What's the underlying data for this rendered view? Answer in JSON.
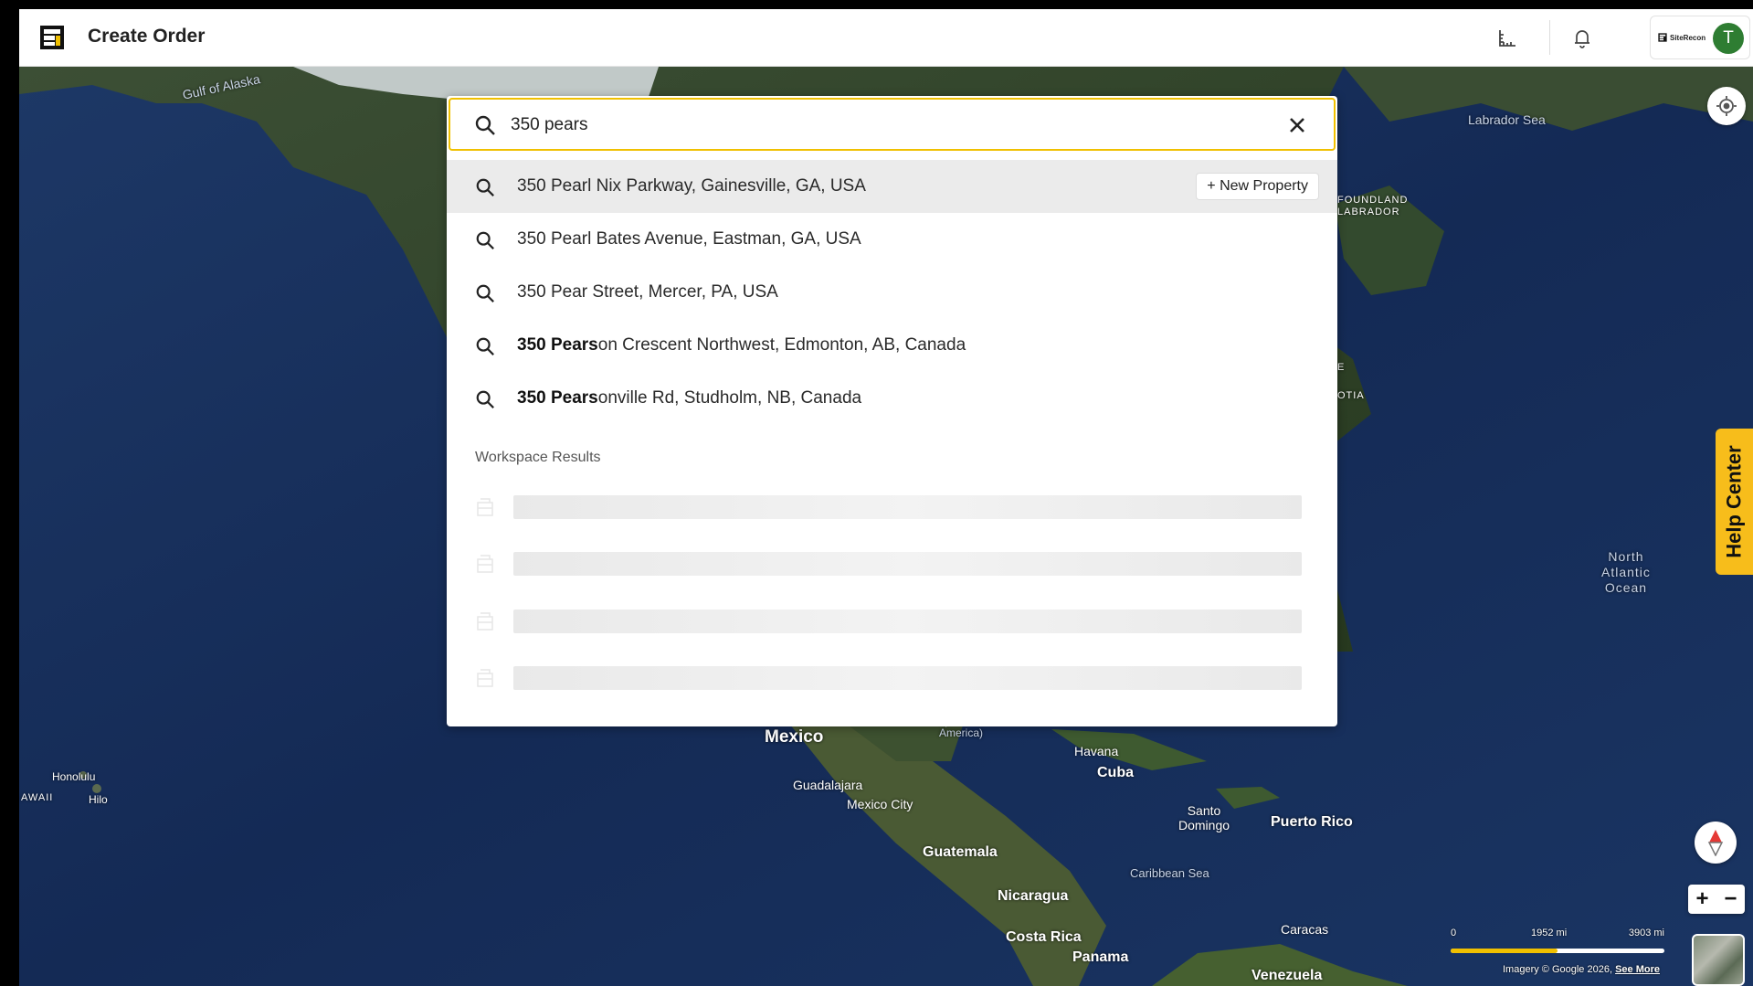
{
  "header": {
    "title": "Create Order",
    "org_name": "SiteRecon",
    "avatar_initial": "T",
    "icons": [
      "logo-icon",
      "measure-icon",
      "bell-icon"
    ]
  },
  "search": {
    "value": "350 pears",
    "placeholder": "",
    "clear_icon": "close-icon",
    "suggestions": [
      {
        "bold": "",
        "rest": "350 Pearl Nix Parkway, Gainesville, GA, USA",
        "action": "+ New Property"
      },
      {
        "bold": "",
        "rest": "350 Pearl Bates Avenue, Eastman, GA, USA"
      },
      {
        "bold": "",
        "rest": "350 Pear Street, Mercer, PA, USA"
      },
      {
        "bold": "350 Pears",
        "rest": "on Crescent Northwest, Edmonton, AB, Canada"
      },
      {
        "bold": "350 Pears",
        "rest": "onville Rd, Studholm, NB, Canada"
      }
    ],
    "workspace_title": "Workspace Results"
  },
  "map": {
    "labels": {
      "gulf_of_alaska": "Gulf of Alaska",
      "labrador_sea": "Labrador Sea",
      "newfoundland": "FOUNDLAND\nLABRADOR",
      "nova_scotia_e": "E",
      "nova_scotia": "OTIA",
      "north_atlantic": "North\nAtlantic\nOcean",
      "central_america": "(Gulf of\nAmerica)",
      "mexico": "Mexico",
      "guadalajara": "Guadalajara",
      "mexico_city": "Mexico City",
      "havana": "Havana",
      "cuba": "Cuba",
      "santo_domingo": "Santo\nDomingo",
      "puerto_rico": "Puerto Rico",
      "guatemala": "Guatemala",
      "caribbean_sea": "Caribbean Sea",
      "nicaragua": "Nicaragua",
      "costa_rica": "Costa Rica",
      "panama": "Panama",
      "caracas": "Caracas",
      "venezuela": "Venezuela",
      "honolulu": "Honolulu",
      "hawaii": "AWAII",
      "hilo": "Hilo"
    },
    "help_center": "Help Center",
    "zoom_in": "+",
    "zoom_out": "−",
    "scale": {
      "start": "0",
      "mid": "1952 mi",
      "end": "3903 mi",
      "fraction": 0.5
    },
    "attribution": "Imagery © Google 2026,",
    "attribution_link": "See More",
    "colors": {
      "accent": "#f0c000",
      "help_tab": "#f7bd1b",
      "avatar": "#2e7d32"
    }
  }
}
